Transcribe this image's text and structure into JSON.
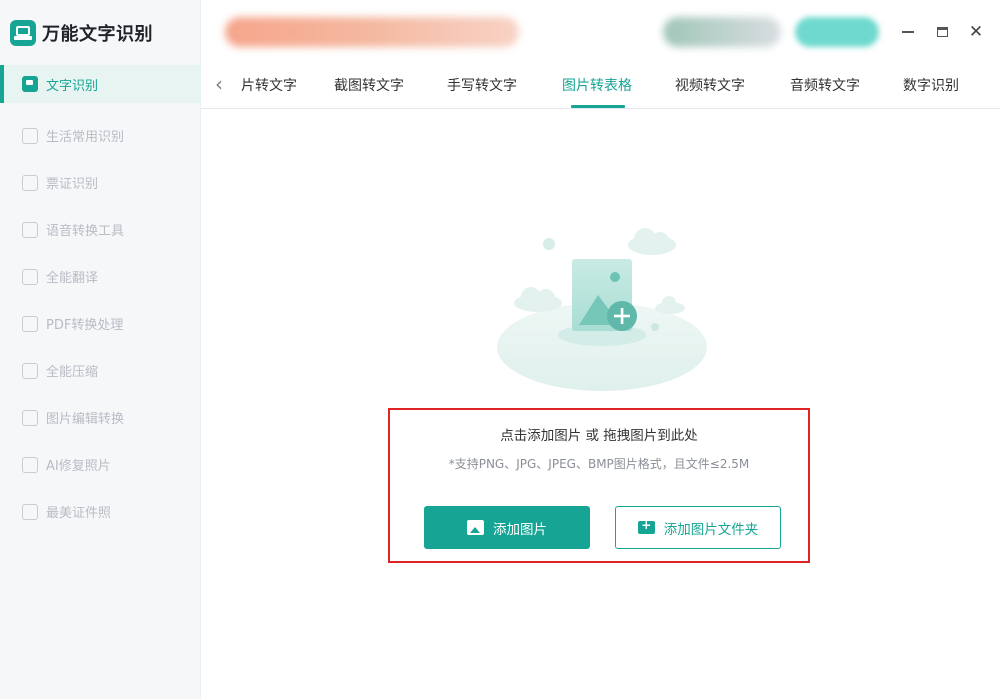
{
  "app": {
    "title": "万能文字识别"
  },
  "colors": {
    "accent": "#16a594",
    "highlight_border": "#e02424"
  },
  "sidebar": {
    "items": [
      {
        "label": "文字识别",
        "icon": "ocr-icon",
        "active": true
      },
      {
        "label": "生活常用识别",
        "icon": "scan-icon"
      },
      {
        "label": "票证识别",
        "icon": "ticket-icon"
      },
      {
        "label": "语音转换工具",
        "icon": "voice-icon"
      },
      {
        "label": "全能翻译",
        "icon": "translate-icon"
      },
      {
        "label": "PDF转换处理",
        "icon": "pdf-icon"
      },
      {
        "label": "全能压缩",
        "icon": "compress-icon"
      },
      {
        "label": "图片编辑转换",
        "icon": "image-edit-icon"
      },
      {
        "label": "AI修复照片",
        "icon": "ai-photo-icon"
      },
      {
        "label": "最美证件照",
        "icon": "id-photo-icon"
      }
    ]
  },
  "tabs": {
    "items": [
      {
        "label": "片转文字"
      },
      {
        "label": "截图转文字"
      },
      {
        "label": "手写转文字"
      },
      {
        "label": "图片转表格",
        "active": true
      },
      {
        "label": "视频转文字"
      },
      {
        "label": "音频转文字"
      },
      {
        "label": "数字识别"
      }
    ]
  },
  "dropzone": {
    "title": "点击添加图片 或 拖拽图片到此处",
    "hint": "*支持PNG、JPG、JPEG、BMP图片格式，且文件≤2.5M",
    "add_image_label": "添加图片",
    "add_folder_label": "添加图片文件夹"
  }
}
